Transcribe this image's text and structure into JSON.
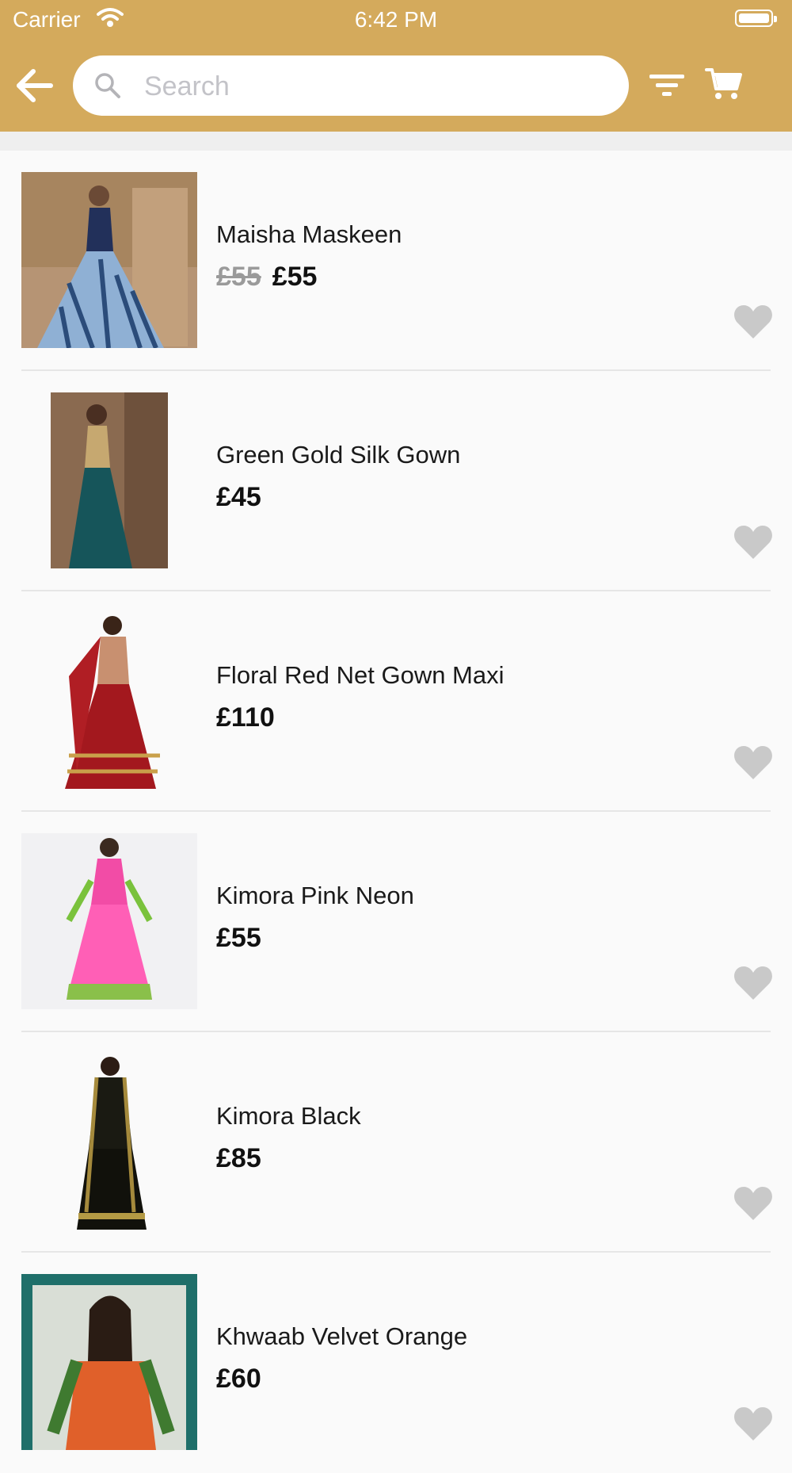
{
  "status_bar": {
    "carrier": "Carrier",
    "time": "6:42 PM"
  },
  "nav": {
    "back_icon": "arrow-left-icon",
    "search_placeholder": "Search",
    "search_value": "",
    "filter_icon": "filter-icon",
    "cart_icon": "cart-icon"
  },
  "colors": {
    "header": "#d4aa5c",
    "background": "#fafafa",
    "heart": "#c9c9c9"
  },
  "products": [
    {
      "name": "Maisha Maskeen",
      "old_price": "£55",
      "price": "£55"
    },
    {
      "name": "Green Gold Silk Gown",
      "old_price": "",
      "price": "£45"
    },
    {
      "name": "Floral Red Net Gown Maxi",
      "old_price": "",
      "price": "£110"
    },
    {
      "name": "Kimora Pink Neon",
      "old_price": "",
      "price": "£55"
    },
    {
      "name": "Kimora Black",
      "old_price": "",
      "price": "£85"
    },
    {
      "name": "Khwaab Velvet Orange",
      "old_price": "",
      "price": "£60"
    }
  ]
}
